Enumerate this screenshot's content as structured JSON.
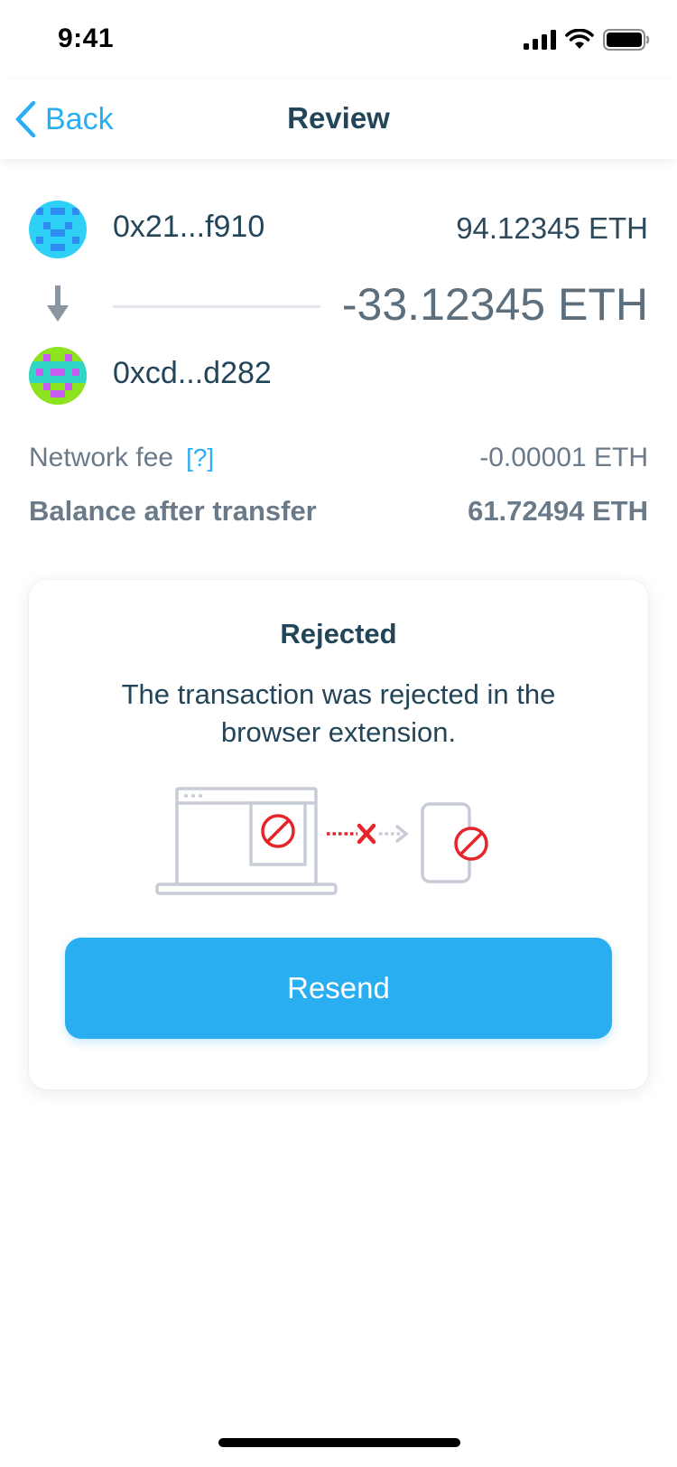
{
  "status_bar": {
    "time": "9:41"
  },
  "nav": {
    "back_label": "Back",
    "title": "Review"
  },
  "transfer": {
    "from_address": "0x21...f910",
    "from_balance": "94.12345 ETH",
    "amount": "-33.12345 ETH",
    "to_address": "0xcd...d282"
  },
  "fee": {
    "label": "Network fee",
    "help": "[?]",
    "value": "-0.00001 ETH"
  },
  "balance_after": {
    "label": "Balance after transfer",
    "value": "61.72494 ETH"
  },
  "card": {
    "title": "Rejected",
    "message": "The transaction was rejected in the browser extension.",
    "button_label": "Resend"
  },
  "colors": {
    "accent": "#2aaef2",
    "error": "#e5252a",
    "text_dark": "#234559",
    "text_muted": "#6b7a88"
  },
  "icons": [
    "back-chevron-icon",
    "arrow-down-icon",
    "blocked-icon",
    "laptop-icon",
    "phone-icon",
    "signal-icon",
    "wifi-icon",
    "battery-icon"
  ]
}
